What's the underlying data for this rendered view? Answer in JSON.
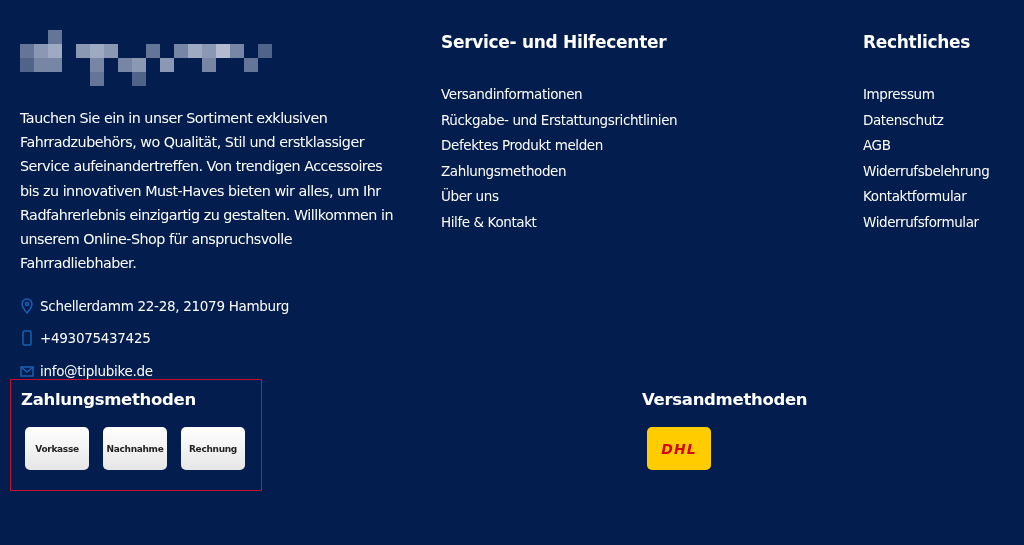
{
  "brand": {
    "description": "Tauchen Sie ein in unser Sortiment exklusiven Fahrradzubehörs, wo Qualität, Stil und erstklassiger Service aufeinandertreffen. Von trendigen Accessoires bis zu innovativen Must-Haves bieten wir alles, um Ihr Radfahrerlebnis einzigartig zu gestalten. Willkommen in unserem Online-Shop für anspruchsvolle Fahrradliebhaber.",
    "contacts": [
      {
        "kind": "address",
        "text": "Schellerdamm 22-28, 21079 Hamburg"
      },
      {
        "kind": "phone",
        "text": "+493075437425"
      },
      {
        "kind": "email",
        "text": "info@tiplubike.de"
      }
    ]
  },
  "columns": [
    {
      "title": "Service- und Hilfecenter",
      "links": [
        "Versandinformationen",
        "Rückgabe- und Erstattungsrichtlinien",
        "Defektes Produkt melden",
        "Zahlungsmethoden",
        "Über uns",
        "Hilfe & Kontakt"
      ]
    },
    {
      "title": "Rechtliches",
      "links": [
        "Impressum",
        "Datenschutz",
        "AGB",
        "Widerrufsbelehrung",
        "Kontaktformular",
        "Widerrufsformular"
      ]
    }
  ],
  "payment": {
    "title": "Zahlungsmethoden",
    "methods": [
      "Vorkasse",
      "Nachnahme",
      "Rechnung"
    ]
  },
  "shipping": {
    "title": "Versandmethoden",
    "carriers": [
      "DHL"
    ]
  }
}
